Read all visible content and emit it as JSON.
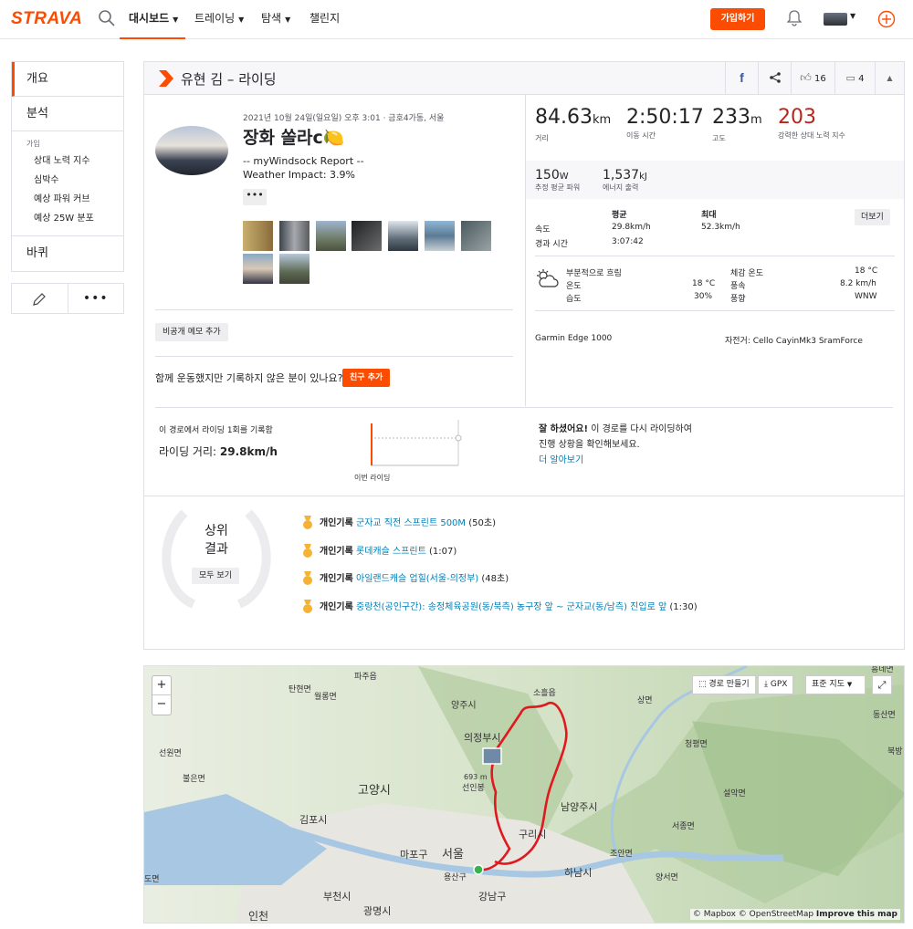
{
  "nav": {
    "logo": "STRAVA",
    "dashboard": "대시보드",
    "training": "트레이닝",
    "explore": "탐색",
    "challenges": "챌린지",
    "join": "가입하기"
  },
  "sidebar": {
    "overview": "개요",
    "analysis": "분석",
    "sub_header": "가입",
    "sub_items": [
      "상대 노력 지수",
      "심박수",
      "예상 파워 커브",
      "예상 25W 분포"
    ],
    "kudos": "바퀴"
  },
  "activity": {
    "header_title": "유현 김 – 라이딩",
    "kudos_count": "16",
    "comment_count": "4",
    "meta": "2021년 10월 24일(일요일) 오후 3:01 · 금호4가동, 서울",
    "title": "장화 쏠라c🍋",
    "desc1": "-- myWindsock Report --",
    "desc2": "Weather Impact: 3.9%",
    "private_note": "비공개 메모 추가",
    "friend_question": "함께 운동했지만 기록하지 않은 분이 있나요?",
    "friend_button": "친구 추가"
  },
  "stats": {
    "distance": "84.63",
    "distance_unit": "km",
    "distance_label": "거리",
    "moving_time": "2:50:17",
    "moving_time_label": "이동 시간",
    "elevation": "233",
    "elevation_unit": "m",
    "elevation_label": "고도",
    "relative_effort": "203",
    "relative_effort_label": "강력한 상대 노력 지수",
    "power": "150",
    "power_unit": "W",
    "power_label": "추정 평균 파워",
    "energy": "1,537",
    "energy_unit": "kJ",
    "energy_label": "에너지 출력",
    "col_avg": "평균",
    "col_max": "최대",
    "more": "더보기",
    "speed_label": "속도",
    "speed_avg": "29.8km/h",
    "speed_max": "52.3km/h",
    "elapsed_label": "경과 시간",
    "elapsed": "3:07:42"
  },
  "weather": {
    "condition": "부분적으로 흐림",
    "temp_label": "온도",
    "temp": "18 °C",
    "humidity_label": "습도",
    "humidity": "30%",
    "feels_label": "체감 온도",
    "feels": "18 °C",
    "wind_label": "풍속",
    "wind": "8.2 km/h",
    "dir_label": "풍향",
    "dir": "WNW"
  },
  "devices": {
    "device": "Garmin Edge 1000",
    "bike": "자전거: Cello CayinMk3 SramForce"
  },
  "segment_effort": {
    "line1": "이 경로에서 라이딩 1회를 기록함",
    "line2_label": "라이딩 거리: ",
    "line2_value": "29.8km/h",
    "chart_label": "이번 라이딩",
    "right_bold": "잘 하셨어요!",
    "right_text1": " 이 경로를 다시 라이딩하여",
    "right_text2": "진행 상황을 확인해보세요.",
    "learn_more": "더 알아보기"
  },
  "top_results": {
    "title1": "상위",
    "title2": "결과",
    "view_all": "모두 보기",
    "items": [
      {
        "badge": "개인기록",
        "name": "군자교 직전 스프린트 500M",
        "time": "(50초)"
      },
      {
        "badge": "개인기록",
        "name": "롯데캐슬 스프린트",
        "time": "(1:07)"
      },
      {
        "badge": "개인기록",
        "name": "아일랜드캐슬 업힐(서울-의정부)",
        "time": "(48초)"
      },
      {
        "badge": "개인기록",
        "name": "중랑천(공인구간): 송정체육공원(동/북측) 농구장 앞 ~ 군자교(동/남측) 진입로 앞",
        "time": "(1:30)"
      }
    ]
  },
  "map": {
    "route_builder": "경로 만들기",
    "gpx": "GPX",
    "map_style": "표준 지도",
    "attribution_1": "© Mapbox © OpenStreetMap ",
    "attribution_2": "Improve this map",
    "labels": [
      {
        "text": "파주읍"
      },
      {
        "text": "소흘읍"
      },
      {
        "text": "탄현면"
      },
      {
        "text": "월롱면"
      },
      {
        "text": "양주시"
      },
      {
        "text": "상면"
      },
      {
        "text": "동산면"
      },
      {
        "text": "의정부시"
      },
      {
        "text": "선원면"
      },
      {
        "text": "청평면"
      },
      {
        "text": "북방"
      },
      {
        "text": "불은면"
      },
      {
        "text": "693 m"
      },
      {
        "text": "선인봉"
      },
      {
        "text": "고양시"
      },
      {
        "text": "설악면"
      },
      {
        "text": "남양주시"
      },
      {
        "text": "김포시"
      },
      {
        "text": "서종면"
      },
      {
        "text": "구리시"
      },
      {
        "text": "마포구"
      },
      {
        "text": "서울"
      },
      {
        "text": "조안면"
      },
      {
        "text": "도면"
      },
      {
        "text": "용산구"
      },
      {
        "text": "하남시"
      },
      {
        "text": "양서면"
      },
      {
        "text": "부천시"
      },
      {
        "text": "강남구"
      },
      {
        "text": "광명시"
      },
      {
        "text": "인천"
      },
      {
        "text": "흥네면"
      }
    ]
  }
}
